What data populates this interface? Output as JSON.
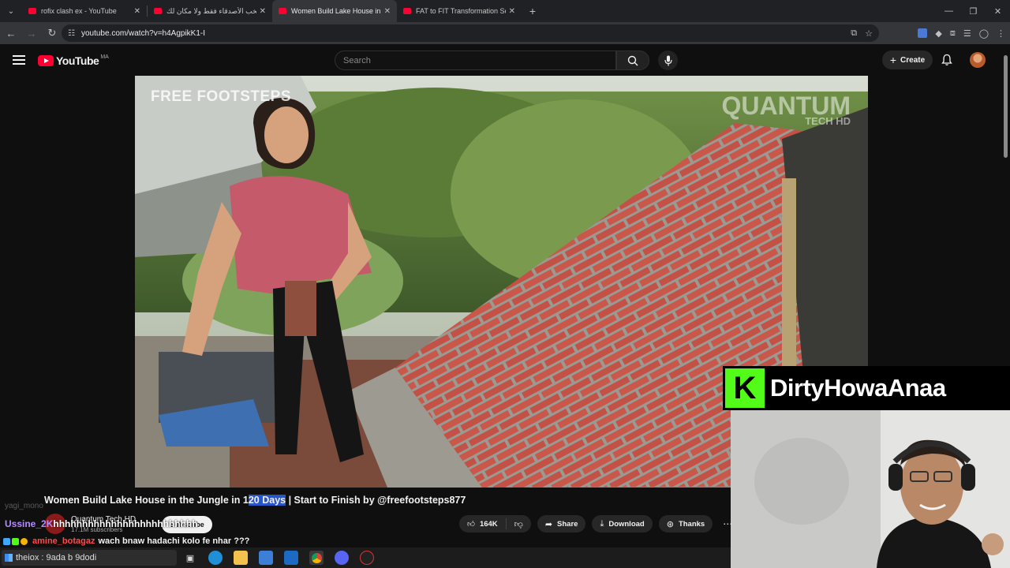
{
  "browser": {
    "tabs": [
      {
        "title": "rofix clash ex - YouTube",
        "active": false
      },
      {
        "title": "منتخب الأصدقاء فقط ولا مكان لك",
        "active": false
      },
      {
        "title": "Women Build Lake House in the Jungle",
        "active": true
      },
      {
        "title": "FAT to FIT Transformation Series",
        "active": false
      }
    ],
    "url": "youtube.com/watch?v=h4AgpikK1-I",
    "new_tab": "+"
  },
  "youtube": {
    "logo_text": "YouTube",
    "region": "MA",
    "search_placeholder": "Search",
    "create_label": "Create",
    "brand_color": "#ff0033"
  },
  "video": {
    "watermark_left": "FREE FOOTSTEPS",
    "watermark_right_main": "QUANTUM",
    "watermark_right_sub": "TECH HD",
    "title_before": "Women Build Lake House in the Jungle in 1",
    "title_highlight": "20 Days",
    "title_after": " | Start to Finish by @freefootsteps877",
    "channel_name": "Quantum Tech HD",
    "subscribers": "17.1M subscribers",
    "subscribe_label": "Subscribe",
    "likes": "164K",
    "share_label": "Share",
    "download_label": "Download",
    "thanks_label": "Thanks"
  },
  "stream_overlay": {
    "kick_logo": "K",
    "streamer_name": "DirtyHowaAnaa",
    "kick_color": "#53fc18"
  },
  "chat": {
    "faded_user": "yagi_mono",
    "msg1_user": "Ussine_2K",
    "msg1_text": "hhhhhhhhhhhhhhhhhhhhhhhhh",
    "msg2_user": "amine_botagaz",
    "msg2_text": "wach bnaw hadachi kolo fe nhar ???"
  },
  "taskbar": {
    "search_text": "theiox : 9ada b 9dodi"
  }
}
